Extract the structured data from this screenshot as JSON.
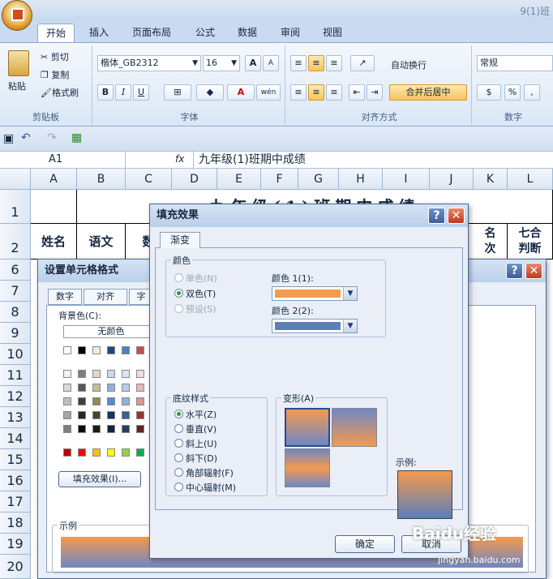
{
  "app": {
    "title": "9(1)班"
  },
  "tabs": [
    "开始",
    "插入",
    "页面布局",
    "公式",
    "数据",
    "审阅",
    "视图"
  ],
  "ribbon": {
    "clipboard": {
      "paste": "粘贴",
      "cut": "剪切",
      "copy": "复制",
      "format_painter": "格式刷",
      "label": "剪贴板"
    },
    "font": {
      "name": "楷体_GB2312",
      "size": "16",
      "label": "字体",
      "bold": "B",
      "italic": "I",
      "underline": "U",
      "grow": "A",
      "shrink": "A",
      "font_color_glyph": "A",
      "phonetic": "wén"
    },
    "alignment": {
      "wrap": "自动换行",
      "merge": "合并后居中",
      "label": "对齐方式"
    },
    "number": {
      "format": "常规",
      "percent": "%",
      "comma": ",",
      "label": "数字"
    }
  },
  "formula_bar": {
    "name_box": "A1",
    "fx": "fx",
    "value": "九年级(1)班期中成绩"
  },
  "columns": [
    "A",
    "B",
    "C",
    "D",
    "E",
    "F",
    "G",
    "H",
    "I",
    "J",
    "K",
    "L"
  ],
  "rows": [
    "1",
    "2",
    "6",
    "7",
    "8",
    "9",
    "10",
    "11",
    "12",
    "13",
    "14",
    "15",
    "16",
    "17",
    "18",
    "19",
    "20"
  ],
  "sheet": {
    "title_partial": "九年级(1)班期中成绩",
    "header_cells": [
      "姓名",
      "语文",
      "数"
    ],
    "k_header": "名次",
    "l_header": "七合判断"
  },
  "format_dialog": {
    "title": "设置单元格格式",
    "tabs": [
      "数字",
      "对齐",
      "字"
    ],
    "bg_label": "背景色(C):",
    "no_color": "无颜色",
    "fill_effects_btn": "填充效果(I)...",
    "sample_label": "示例"
  },
  "fill_dialog": {
    "title": "填充效果",
    "tab": "渐变",
    "colors_group": "颜色",
    "one_color": "单色(N)",
    "two_colors": "双色(T)",
    "preset": "预设(S)",
    "color1_label": "颜色 1(1):",
    "color2_label": "颜色 2(2):",
    "color1": "#f49a4d",
    "color2": "#5b7fb9",
    "shading_group": "底纹样式",
    "shading": [
      "水平(Z)",
      "垂直(V)",
      "斜上(U)",
      "斜下(D)",
      "角部辐射(F)",
      "中心辐射(M)"
    ],
    "variants_group": "变形(A)",
    "sample_label": "示例:",
    "ok": "确定",
    "cancel": "取消"
  },
  "watermark": {
    "brand": "Baidu经验",
    "url": "jingyan.baidu.com"
  }
}
